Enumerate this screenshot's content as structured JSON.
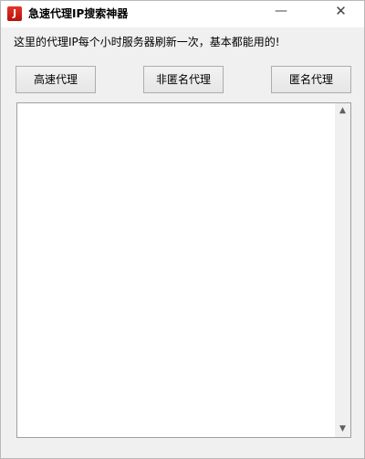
{
  "window": {
    "title": "急速代理IP搜索神器",
    "icon": "app-logo-icon",
    "minimize_glyph": "—",
    "close_glyph": "✕"
  },
  "info": {
    "text": "这里的代理IP每个小时服务器刷新一次，基本都能用的!"
  },
  "buttons": {
    "fast_proxy": "高速代理",
    "non_anonymous_proxy": "非匿名代理",
    "anonymous_proxy": "匿名代理"
  },
  "scrollbar": {
    "up_glyph": "▲",
    "down_glyph": "▼"
  },
  "colors": {
    "accent": "#d42a20"
  }
}
